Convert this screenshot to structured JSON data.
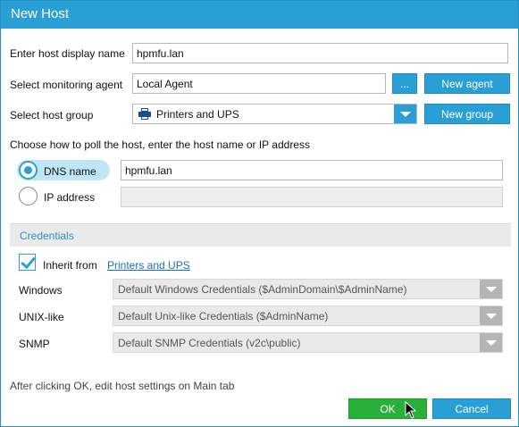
{
  "window": {
    "title": "New Host"
  },
  "display_name": {
    "label": "Enter host display name",
    "value": "hpmfu.lan"
  },
  "agent": {
    "label": "Select monitoring agent",
    "value": "Local Agent",
    "browse_label": "...",
    "new_label": "New agent"
  },
  "group": {
    "label": "Select host group",
    "value": "Printers and UPS",
    "icon": "printer-icon",
    "new_label": "New group"
  },
  "poll": {
    "hint": "Choose how to poll the host, enter the host name or IP address",
    "dns_label": "DNS name",
    "dns_value": "hpmfu.lan",
    "ip_label": "IP address",
    "ip_value": "",
    "selected": "dns"
  },
  "credentials": {
    "section_title": "Credentials",
    "inherit_label": "Inherit from",
    "inherit_link": "Printers and UPS",
    "inherit_checked": true,
    "rows": [
      {
        "label": "Windows",
        "value": "Default Windows Credentials ($AdminDomain\\$AdminName)"
      },
      {
        "label": "UNIX-like",
        "value": "Default Unix-like Credentials ($AdminName)"
      },
      {
        "label": "SNMP",
        "value": "Default SNMP Credentials (v2c\\public)"
      }
    ]
  },
  "footer": {
    "note": "After clicking OK, edit host settings on Main tab",
    "ok_label": "OK",
    "cancel_label": "Cancel"
  },
  "colors": {
    "accent": "#2a9fd6",
    "ok": "#29b03a",
    "link": "#1a6fb8",
    "section_title": "#2a8fc6"
  }
}
